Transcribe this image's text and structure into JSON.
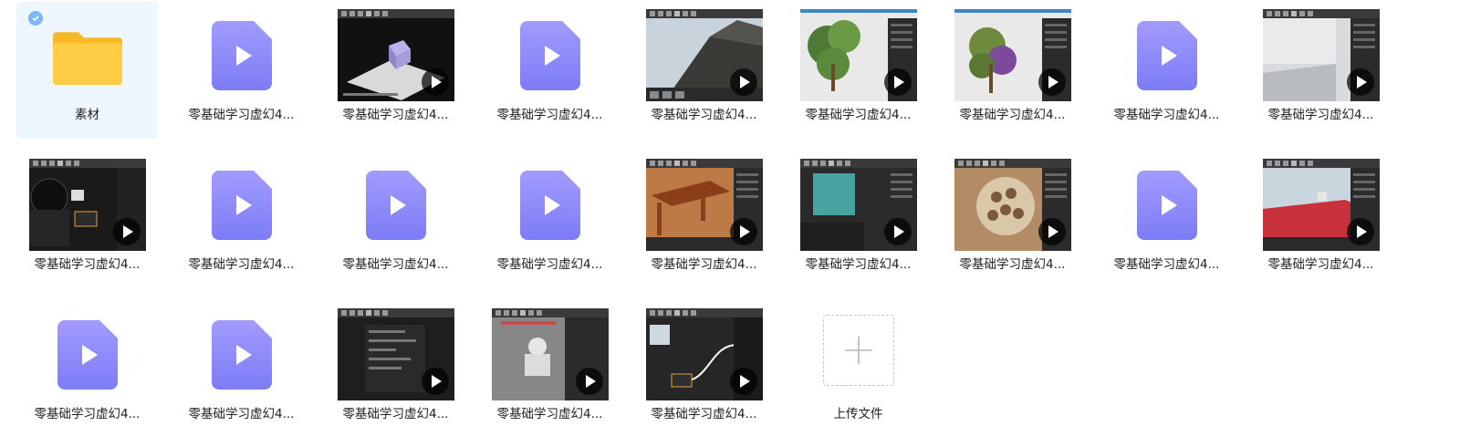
{
  "items": [
    {
      "kind": "folder",
      "name": "素材",
      "selected": true,
      "icon": "folder-icon",
      "color": "#ffcd45"
    },
    {
      "kind": "video-file",
      "name": "零基础学习虚幻4...",
      "icon": "play-file-icon"
    },
    {
      "kind": "video-thumb",
      "name": "零基础学习虚幻4...",
      "scene": "cube-viewport"
    },
    {
      "kind": "video-file",
      "name": "零基础学习虚幻4...",
      "icon": "play-file-icon"
    },
    {
      "kind": "video-thumb",
      "name": "零基础学习虚幻4...",
      "scene": "building-viewport"
    },
    {
      "kind": "video-thumb",
      "name": "零基础学习虚幻4...",
      "scene": "tree-editor"
    },
    {
      "kind": "video-thumb",
      "name": "零基础学习虚幻4...",
      "scene": "tree-editor-purple"
    },
    {
      "kind": "video-file",
      "name": "零基础学习虚幻4...",
      "icon": "play-file-icon"
    },
    {
      "kind": "video-thumb",
      "name": "零基础学习虚幻4...",
      "scene": "gray-room"
    },
    {
      "kind": "video-thumb",
      "name": "零基础学习虚幻4...",
      "scene": "material-editor-dark"
    },
    {
      "kind": "video-file",
      "name": "零基础学习虚幻4...",
      "icon": "play-file-icon"
    },
    {
      "kind": "video-file",
      "name": "零基础学习虚幻4...",
      "icon": "play-file-icon"
    },
    {
      "kind": "video-file",
      "name": "零基础学习虚幻4...",
      "icon": "play-file-icon"
    },
    {
      "kind": "video-thumb",
      "name": "零基础学习虚幻4...",
      "scene": "wooden-table"
    },
    {
      "kind": "video-thumb",
      "name": "零基础学习虚幻4...",
      "scene": "teal-material"
    },
    {
      "kind": "video-thumb",
      "name": "零基础学习虚幻4...",
      "scene": "sphere-pattern"
    },
    {
      "kind": "video-file",
      "name": "零基础学习虚幻4...",
      "icon": "play-file-icon"
    },
    {
      "kind": "video-thumb",
      "name": "零基础学习虚幻4...",
      "scene": "red-floor"
    },
    {
      "kind": "video-file",
      "name": "零基础学习虚幻4...",
      "icon": "play-file-icon"
    },
    {
      "kind": "video-file",
      "name": "零基础学习虚幻4...",
      "icon": "play-file-icon"
    },
    {
      "kind": "video-thumb",
      "name": "零基础学习虚幻4...",
      "scene": "details-panel"
    },
    {
      "kind": "video-thumb",
      "name": "零基础学习虚幻4...",
      "scene": "white-statue"
    },
    {
      "kind": "video-thumb",
      "name": "零基础学习虚幻4...",
      "scene": "node-graph"
    },
    {
      "kind": "upload",
      "name": "上传文件",
      "icon": "plus-icon"
    }
  ],
  "colors": {
    "play_file_top": "#a29bfe",
    "play_file_bottom": "#7c7cf5",
    "selected_bg": "#eef6ff",
    "check": "#7cb6f5"
  }
}
